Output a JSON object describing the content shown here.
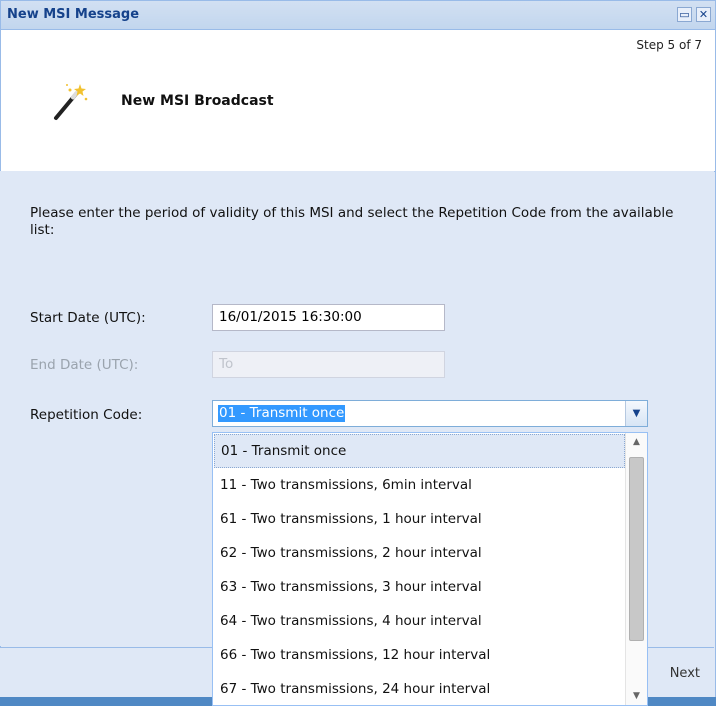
{
  "window": {
    "title": "New MSI Message",
    "restore_icon": "restore-icon",
    "close_icon": "close-icon"
  },
  "header": {
    "step": "Step 5 of 7",
    "title": "New MSI Broadcast",
    "icon": "magic-wand-icon"
  },
  "form": {
    "instructions": "Please enter the period of validity of this MSI and select the Repetition Code from the available list:",
    "start_label": "Start Date (UTC):",
    "start_value": "16/01/2015 16:30:00",
    "end_label": "End Date (UTC):",
    "end_placeholder": "To",
    "repetition_label": "Repetition Code:",
    "repetition_value": "01 - Transmit once"
  },
  "dropdown": {
    "options": [
      "01 - Transmit once",
      "11 - Two transmissions, 6min interval",
      "61 - Two transmissions, 1 hour interval",
      "62 - Two transmissions, 2 hour interval",
      "63 - Two transmissions, 3 hour interval",
      "64 - Two transmissions, 4 hour interval",
      "66 - Two transmissions, 12 hour interval",
      "67 - Two transmissions, 24 hour interval"
    ],
    "selected_index": 0
  },
  "footer": {
    "next_label": "Next"
  },
  "colors": {
    "accent": "#15428b",
    "panel": "#dfe8f6",
    "border": "#99bbe8",
    "selection": "#3399ff"
  }
}
